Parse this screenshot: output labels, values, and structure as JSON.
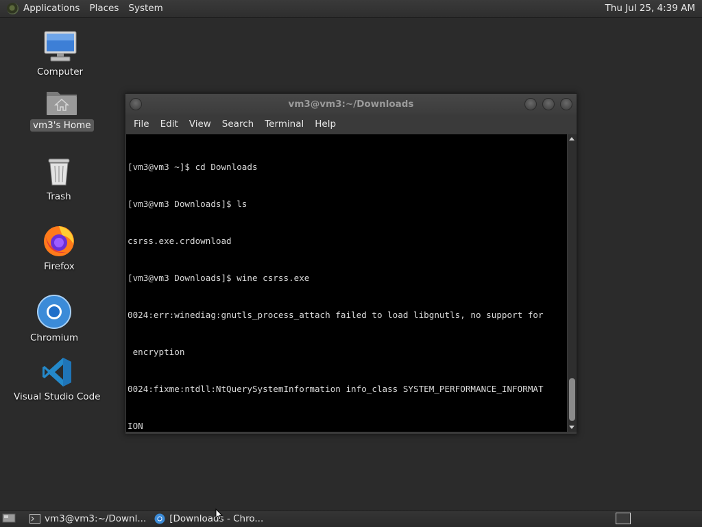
{
  "top_panel": {
    "menus": [
      "Applications",
      "Places",
      "System"
    ],
    "clock": "Thu Jul 25,  4:39 AM"
  },
  "desktop": {
    "icons": [
      {
        "label": "Computer",
        "icon": "computer-icon"
      },
      {
        "label": "vm3's Home",
        "icon": "home-folder-icon",
        "selected": true
      },
      {
        "label": "Trash",
        "icon": "trash-icon"
      },
      {
        "label": "Firefox",
        "icon": "firefox-icon"
      },
      {
        "label": "Chromium",
        "icon": "chromium-icon"
      },
      {
        "label": "Visual Studio Code",
        "icon": "vscode-icon"
      }
    ]
  },
  "terminal": {
    "title": "vm3@vm3:~/Downloads",
    "menu": [
      "File",
      "Edit",
      "View",
      "Search",
      "Terminal",
      "Help"
    ],
    "lines": [
      "[vm3@vm3 ~]$ cd Downloads",
      "[vm3@vm3 Downloads]$ ls",
      "csrss.exe.crdownload",
      "[vm3@vm3 Downloads]$ wine csrss.exe",
      "0024:err:winediag:gnutls_process_attach failed to load libgnutls, no support for",
      " encryption",
      "0024:fixme:ntdll:NtQuerySystemInformation info_class SYSTEM_PERFORMANCE_INFORMAT",
      "ION"
    ]
  },
  "taskbar": {
    "tasks": [
      {
        "label": "vm3@vm3:~/Downl...",
        "icon": "terminal-icon"
      },
      {
        "label": "[Downloads - Chro...",
        "icon": "chromium-icon"
      }
    ]
  },
  "colors": {
    "desktop_bg": "#2b2b2b",
    "terminal_bg": "#000000",
    "terminal_fg": "#d9d9d9"
  }
}
